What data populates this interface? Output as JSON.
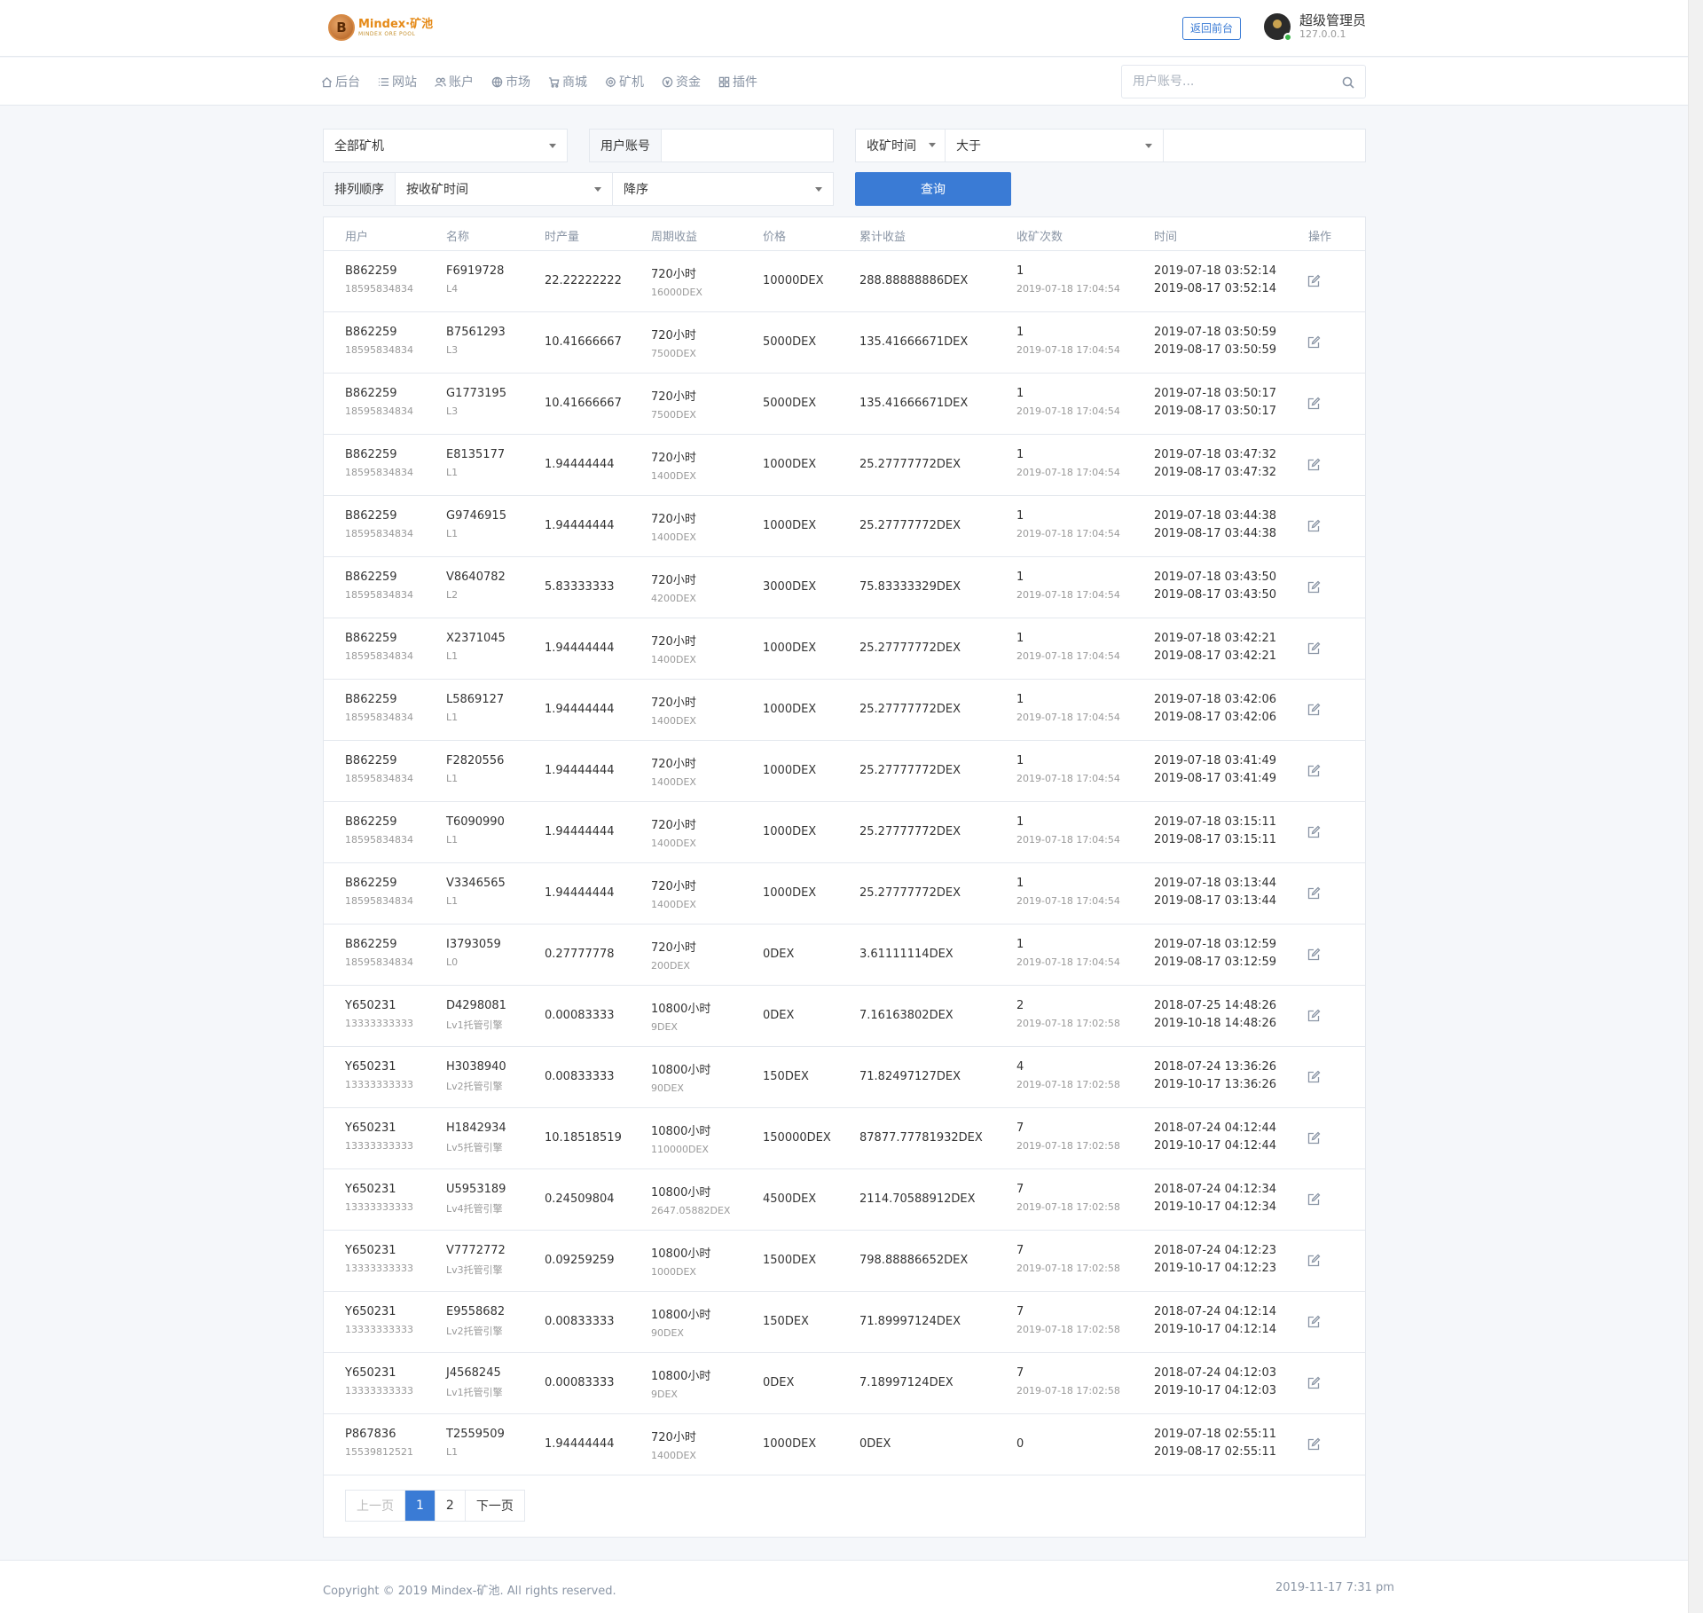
{
  "brand": {
    "title": "Mindex·矿池",
    "subtitle": "MINDEX ORE POOL",
    "coin_letter": "B"
  },
  "header": {
    "back_label": "返回前台",
    "user_name": "超级管理员",
    "user_ip": "127.0.0.1"
  },
  "nav": {
    "items": [
      {
        "label": "后台",
        "icon": "home-icon"
      },
      {
        "label": "网站",
        "icon": "list-icon"
      },
      {
        "label": "账户",
        "icon": "users-icon"
      },
      {
        "label": "市场",
        "icon": "globe-icon"
      },
      {
        "label": "商城",
        "icon": "cart-icon"
      },
      {
        "label": "矿机",
        "icon": "gear-icon"
      },
      {
        "label": "资金",
        "icon": "coin-icon"
      },
      {
        "label": "插件",
        "icon": "grid-icon"
      }
    ],
    "search_placeholder": "用户账号..."
  },
  "filters": {
    "miner_select": "全部矿机",
    "account_label": "用户账号",
    "account_value": "",
    "time_field": "收矿时间",
    "compare": "大于",
    "compare_value": "",
    "sort_label": "排列顺序",
    "sort_by": "按收矿时间",
    "sort_dir": "降序",
    "query_label": "查询"
  },
  "table": {
    "headers": [
      "用户",
      "名称",
      "时产量",
      "周期收益",
      "价格",
      "累计收益",
      "收矿次数",
      "时间",
      "操作"
    ],
    "rows": [
      {
        "user": "B862259",
        "phone": "18595834834",
        "name": "F6919728",
        "level": "L4",
        "rate": "22.22222222",
        "cycle": "720小时",
        "cycle_income": "16000DEX",
        "price": "10000DEX",
        "total": "288.88888886DEX",
        "count": "1",
        "count_time": "2019-07-18 17:04:54",
        "start": "2019-07-18 03:52:14",
        "end": "2019-08-17 03:52:14"
      },
      {
        "user": "B862259",
        "phone": "18595834834",
        "name": "B7561293",
        "level": "L3",
        "rate": "10.41666667",
        "cycle": "720小时",
        "cycle_income": "7500DEX",
        "price": "5000DEX",
        "total": "135.41666671DEX",
        "count": "1",
        "count_time": "2019-07-18 17:04:54",
        "start": "2019-07-18 03:50:59",
        "end": "2019-08-17 03:50:59"
      },
      {
        "user": "B862259",
        "phone": "18595834834",
        "name": "G1773195",
        "level": "L3",
        "rate": "10.41666667",
        "cycle": "720小时",
        "cycle_income": "7500DEX",
        "price": "5000DEX",
        "total": "135.41666671DEX",
        "count": "1",
        "count_time": "2019-07-18 17:04:54",
        "start": "2019-07-18 03:50:17",
        "end": "2019-08-17 03:50:17"
      },
      {
        "user": "B862259",
        "phone": "18595834834",
        "name": "E8135177",
        "level": "L1",
        "rate": "1.94444444",
        "cycle": "720小时",
        "cycle_income": "1400DEX",
        "price": "1000DEX",
        "total": "25.27777772DEX",
        "count": "1",
        "count_time": "2019-07-18 17:04:54",
        "start": "2019-07-18 03:47:32",
        "end": "2019-08-17 03:47:32"
      },
      {
        "user": "B862259",
        "phone": "18595834834",
        "name": "G9746915",
        "level": "L1",
        "rate": "1.94444444",
        "cycle": "720小时",
        "cycle_income": "1400DEX",
        "price": "1000DEX",
        "total": "25.27777772DEX",
        "count": "1",
        "count_time": "2019-07-18 17:04:54",
        "start": "2019-07-18 03:44:38",
        "end": "2019-08-17 03:44:38"
      },
      {
        "user": "B862259",
        "phone": "18595834834",
        "name": "V8640782",
        "level": "L2",
        "rate": "5.83333333",
        "cycle": "720小时",
        "cycle_income": "4200DEX",
        "price": "3000DEX",
        "total": "75.83333329DEX",
        "count": "1",
        "count_time": "2019-07-18 17:04:54",
        "start": "2019-07-18 03:43:50",
        "end": "2019-08-17 03:43:50"
      },
      {
        "user": "B862259",
        "phone": "18595834834",
        "name": "X2371045",
        "level": "L1",
        "rate": "1.94444444",
        "cycle": "720小时",
        "cycle_income": "1400DEX",
        "price": "1000DEX",
        "total": "25.27777772DEX",
        "count": "1",
        "count_time": "2019-07-18 17:04:54",
        "start": "2019-07-18 03:42:21",
        "end": "2019-08-17 03:42:21"
      },
      {
        "user": "B862259",
        "phone": "18595834834",
        "name": "L5869127",
        "level": "L1",
        "rate": "1.94444444",
        "cycle": "720小时",
        "cycle_income": "1400DEX",
        "price": "1000DEX",
        "total": "25.27777772DEX",
        "count": "1",
        "count_time": "2019-07-18 17:04:54",
        "start": "2019-07-18 03:42:06",
        "end": "2019-08-17 03:42:06"
      },
      {
        "user": "B862259",
        "phone": "18595834834",
        "name": "F2820556",
        "level": "L1",
        "rate": "1.94444444",
        "cycle": "720小时",
        "cycle_income": "1400DEX",
        "price": "1000DEX",
        "total": "25.27777772DEX",
        "count": "1",
        "count_time": "2019-07-18 17:04:54",
        "start": "2019-07-18 03:41:49",
        "end": "2019-08-17 03:41:49"
      },
      {
        "user": "B862259",
        "phone": "18595834834",
        "name": "T6090990",
        "level": "L1",
        "rate": "1.94444444",
        "cycle": "720小时",
        "cycle_income": "1400DEX",
        "price": "1000DEX",
        "total": "25.27777772DEX",
        "count": "1",
        "count_time": "2019-07-18 17:04:54",
        "start": "2019-07-18 03:15:11",
        "end": "2019-08-17 03:15:11"
      },
      {
        "user": "B862259",
        "phone": "18595834834",
        "name": "V3346565",
        "level": "L1",
        "rate": "1.94444444",
        "cycle": "720小时",
        "cycle_income": "1400DEX",
        "price": "1000DEX",
        "total": "25.27777772DEX",
        "count": "1",
        "count_time": "2019-07-18 17:04:54",
        "start": "2019-07-18 03:13:44",
        "end": "2019-08-17 03:13:44"
      },
      {
        "user": "B862259",
        "phone": "18595834834",
        "name": "I3793059",
        "level": "L0",
        "rate": "0.27777778",
        "cycle": "720小时",
        "cycle_income": "200DEX",
        "price": "0DEX",
        "total": "3.61111114DEX",
        "count": "1",
        "count_time": "2019-07-18 17:04:54",
        "start": "2019-07-18 03:12:59",
        "end": "2019-08-17 03:12:59"
      },
      {
        "user": "Y650231",
        "phone": "13333333333",
        "name": "D4298081",
        "level": "Lv1托管引擎",
        "rate": "0.00083333",
        "cycle": "10800小时",
        "cycle_income": "9DEX",
        "price": "0DEX",
        "total": "7.16163802DEX",
        "count": "2",
        "count_time": "2019-07-18 17:02:58",
        "start": "2018-07-25 14:48:26",
        "end": "2019-10-18 14:48:26"
      },
      {
        "user": "Y650231",
        "phone": "13333333333",
        "name": "H3038940",
        "level": "Lv2托管引擎",
        "rate": "0.00833333",
        "cycle": "10800小时",
        "cycle_income": "90DEX",
        "price": "150DEX",
        "total": "71.82497127DEX",
        "count": "4",
        "count_time": "2019-07-18 17:02:58",
        "start": "2018-07-24 13:36:26",
        "end": "2019-10-17 13:36:26"
      },
      {
        "user": "Y650231",
        "phone": "13333333333",
        "name": "H1842934",
        "level": "Lv5托管引擎",
        "rate": "10.18518519",
        "cycle": "10800小时",
        "cycle_income": "110000DEX",
        "price": "150000DEX",
        "total": "87877.77781932DEX",
        "count": "7",
        "count_time": "2019-07-18 17:02:58",
        "start": "2018-07-24 04:12:44",
        "end": "2019-10-17 04:12:44"
      },
      {
        "user": "Y650231",
        "phone": "13333333333",
        "name": "U5953189",
        "level": "Lv4托管引擎",
        "rate": "0.24509804",
        "cycle": "10800小时",
        "cycle_income": "2647.05882DEX",
        "price": "4500DEX",
        "total": "2114.70588912DEX",
        "count": "7",
        "count_time": "2019-07-18 17:02:58",
        "start": "2018-07-24 04:12:34",
        "end": "2019-10-17 04:12:34"
      },
      {
        "user": "Y650231",
        "phone": "13333333333",
        "name": "V7772772",
        "level": "Lv3托管引擎",
        "rate": "0.09259259",
        "cycle": "10800小时",
        "cycle_income": "1000DEX",
        "price": "1500DEX",
        "total": "798.88886652DEX",
        "count": "7",
        "count_time": "2019-07-18 17:02:58",
        "start": "2018-07-24 04:12:23",
        "end": "2019-10-17 04:12:23"
      },
      {
        "user": "Y650231",
        "phone": "13333333333",
        "name": "E9558682",
        "level": "Lv2托管引擎",
        "rate": "0.00833333",
        "cycle": "10800小时",
        "cycle_income": "90DEX",
        "price": "150DEX",
        "total": "71.89997124DEX",
        "count": "7",
        "count_time": "2019-07-18 17:02:58",
        "start": "2018-07-24 04:12:14",
        "end": "2019-10-17 04:12:14"
      },
      {
        "user": "Y650231",
        "phone": "13333333333",
        "name": "J4568245",
        "level": "Lv1托管引擎",
        "rate": "0.00083333",
        "cycle": "10800小时",
        "cycle_income": "9DEX",
        "price": "0DEX",
        "total": "7.18997124DEX",
        "count": "7",
        "count_time": "2019-07-18 17:02:58",
        "start": "2018-07-24 04:12:03",
        "end": "2019-10-17 04:12:03"
      },
      {
        "user": "P867836",
        "phone": "15539812521",
        "name": "T2559509",
        "level": "L1",
        "rate": "1.94444444",
        "cycle": "720小时",
        "cycle_income": "1400DEX",
        "price": "1000DEX",
        "total": "0DEX",
        "count": "0",
        "count_time": "",
        "start": "2019-07-18 02:55:11",
        "end": "2019-08-17 02:55:11"
      }
    ]
  },
  "pagination": {
    "prev": "上一页",
    "pages": [
      "1",
      "2"
    ],
    "current": "1",
    "next": "下一页"
  },
  "footer": {
    "copyright": "Copyright © 2019 Mindex-矿池. All rights reserved.",
    "time": "2019-11-17 7:31 pm"
  }
}
